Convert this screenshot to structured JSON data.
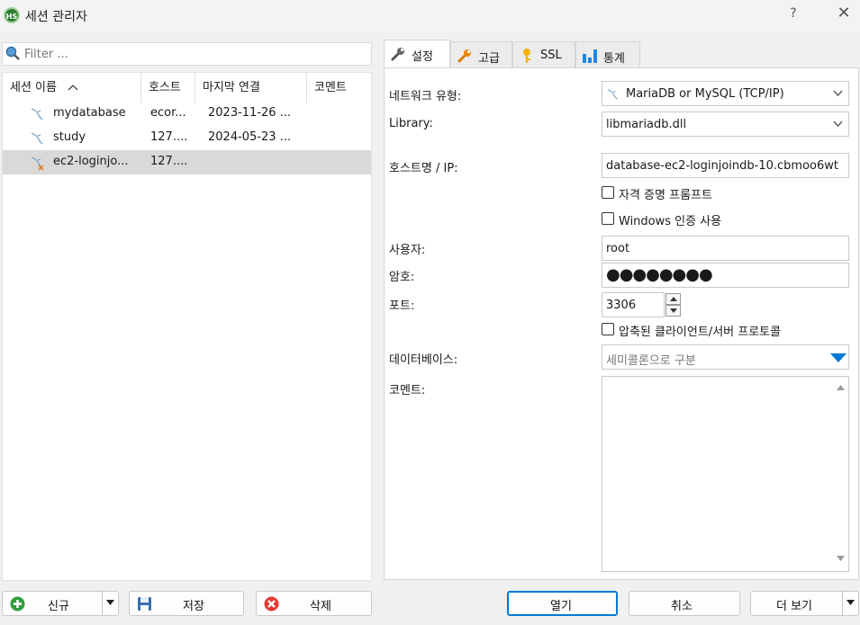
{
  "window": {
    "title": "세션 관리자",
    "help": "?",
    "close": "✕",
    "app_icon": "HS"
  },
  "filter": {
    "placeholder": "Filter ..."
  },
  "columns": {
    "name": "세션 이름",
    "host": "호스트",
    "last": "마지막 연결",
    "comment": "코멘트"
  },
  "sessions": [
    {
      "name": "mydatabase",
      "host": "ecor...",
      "last": "2023-11-26 ..."
    },
    {
      "name": "study",
      "host": "127....",
      "last": "2024-05-23 ..."
    },
    {
      "name": "ec2-loginjo...",
      "host": "127....",
      "last": ""
    }
  ],
  "buttons": {
    "new": "신규",
    "save": "저장",
    "delete": "삭제",
    "open": "열기",
    "cancel": "취소",
    "more": "더 보기"
  },
  "tabs": [
    "설정",
    "고급",
    "SSL",
    "통계"
  ],
  "form": {
    "network_label": "네트워크 유형:",
    "network_value": "MariaDB or MySQL (TCP/IP)",
    "library_label": "Library:",
    "library_value": "libmariadb.dll",
    "host_label": "호스트명 / IP:",
    "host_value": "database-ec2-loginjoindb-10.cbmoo6wt",
    "prompt_label": "자격 증명 프롬프트",
    "windows_auth_label": "Windows 인증 사용",
    "user_label": "사용자:",
    "user_value": "root",
    "password_label": "암호:",
    "password_value": "●●●●●●●●",
    "port_label": "포트:",
    "port_value": "3306",
    "compress_label": "압축된 클라이언트/서버 프로토콜",
    "database_label": "데이터베이스:",
    "database_placeholder": "세미콜론으로 구분",
    "comment_label": "코멘트:"
  },
  "colors": {
    "accent": "#0078d4",
    "selected_row": "#d9d9d9",
    "green": "#2e9e3e",
    "red": "#e53935"
  }
}
